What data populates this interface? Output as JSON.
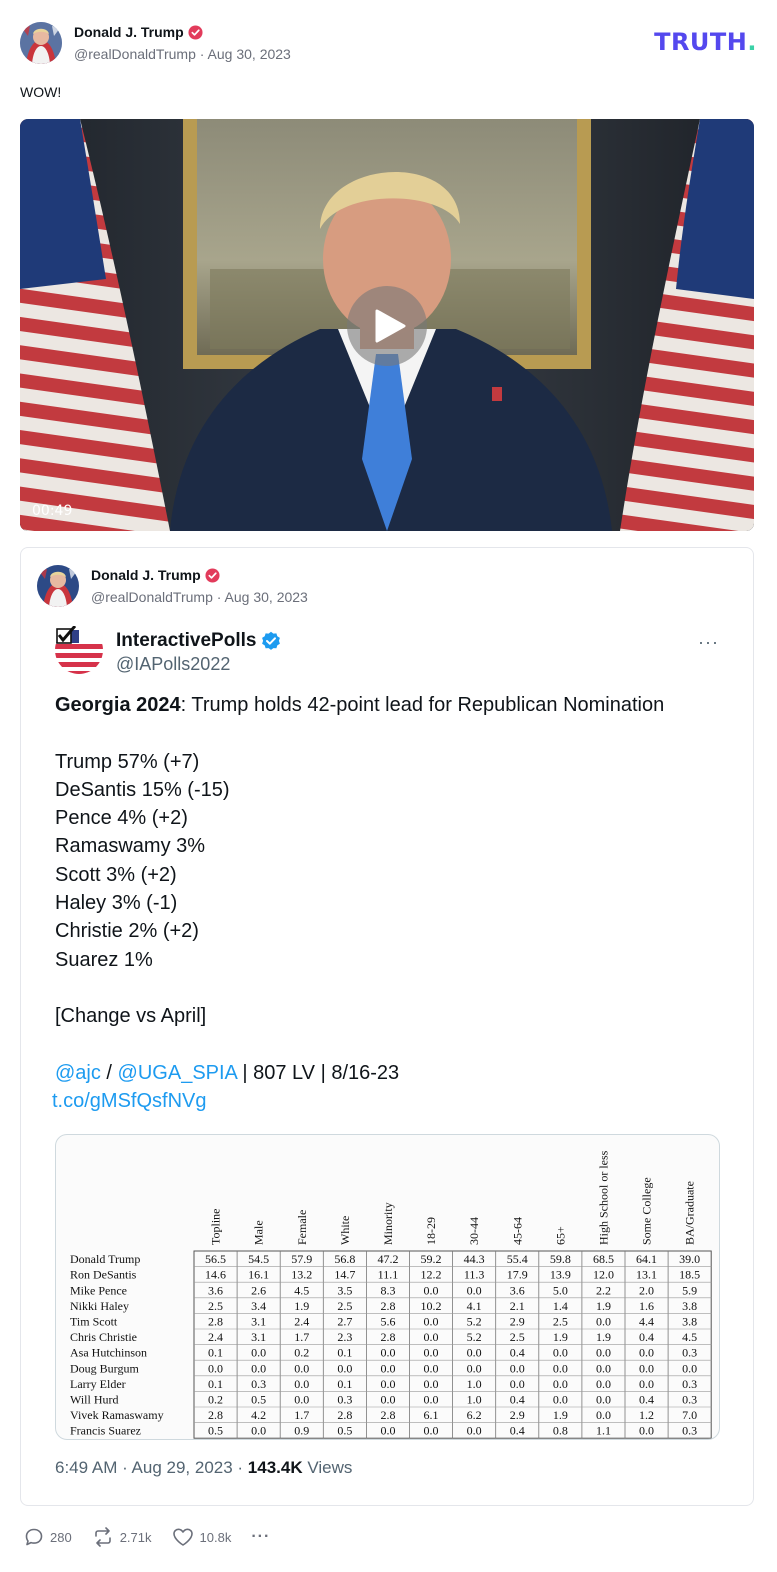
{
  "post": {
    "author_name": "Donald J. Trump",
    "handle": "@realDonaldTrump",
    "separator": "·",
    "date": "Aug 30, 2023",
    "brand": "TRUTH",
    "brand_dot": ".",
    "text": "WOW!",
    "video_duration": "00:49",
    "colors": {
      "brand": "#5448ee",
      "brand_dot": "#3bd1a7",
      "verified": "#e23b5b"
    }
  },
  "quote": {
    "author_name": "Donald J. Trump",
    "handle": "@realDonaldTrump",
    "separator": "·",
    "date": "Aug 30, 2023"
  },
  "tweet": {
    "name": "InteractivePolls",
    "handle": "@IAPolls2022",
    "more": "···",
    "headline_bold": "Georgia 2024",
    "headline_rest": ": Trump holds 42-point lead for Republican Nomination",
    "results": [
      "Trump 57% (+7)",
      "DeSantis 15% (-15)",
      "Pence 4% (+2)",
      "Ramaswamy 3%",
      "Scott 3% (+2)",
      "Haley 3% (-1)",
      "Christie 2% (+2)",
      "Suarez 1%"
    ],
    "change_note": "[Change vs April]",
    "mention1": "@ajc",
    "slash": " / ",
    "mention2": "@UGA_SPIA",
    "source_rest": " | 807 LV | 8/16-23",
    "short_link": "t.co/gMSfQsfNVg",
    "time": "6:49 AM · Aug 29, 2023 · ",
    "views_count": "143.4K",
    "views_label": " Views",
    "colors": {
      "link": "#1d9bf0",
      "verified": "#1d9bf0"
    }
  },
  "poll_table": {
    "columns": [
      "Topline",
      "Male",
      "Female",
      "White",
      "Minority",
      "18-29",
      "30-44",
      "45-64",
      "65+",
      "High School or less",
      "Some College",
      "BA/Graduate"
    ],
    "rows": [
      {
        "label": "Donald Trump",
        "values": [
          "56.5",
          "54.5",
          "57.9",
          "56.8",
          "47.2",
          "59.2",
          "44.3",
          "55.4",
          "59.8",
          "68.5",
          "64.1",
          "39.0"
        ]
      },
      {
        "label": "Ron DeSantis",
        "values": [
          "14.6",
          "16.1",
          "13.2",
          "14.7",
          "11.1",
          "12.2",
          "11.3",
          "17.9",
          "13.9",
          "12.0",
          "13.1",
          "18.5"
        ]
      },
      {
        "label": "Mike Pence",
        "values": [
          "3.6",
          "2.6",
          "4.5",
          "3.5",
          "8.3",
          "0.0",
          "0.0",
          "3.6",
          "5.0",
          "2.2",
          "2.0",
          "5.9"
        ]
      },
      {
        "label": "Nikki Haley",
        "values": [
          "2.5",
          "3.4",
          "1.9",
          "2.5",
          "2.8",
          "10.2",
          "4.1",
          "2.1",
          "1.4",
          "1.9",
          "1.6",
          "3.8"
        ]
      },
      {
        "label": "Tim Scott",
        "values": [
          "2.8",
          "3.1",
          "2.4",
          "2.7",
          "5.6",
          "0.0",
          "5.2",
          "2.9",
          "2.5",
          "0.0",
          "4.4",
          "3.8"
        ]
      },
      {
        "label": "Chris Christie",
        "values": [
          "2.4",
          "3.1",
          "1.7",
          "2.3",
          "2.8",
          "0.0",
          "5.2",
          "2.5",
          "1.9",
          "1.9",
          "0.4",
          "4.5"
        ]
      },
      {
        "label": "Asa Hutchinson",
        "values": [
          "0.1",
          "0.0",
          "0.2",
          "0.1",
          "0.0",
          "0.0",
          "0.0",
          "0.4",
          "0.0",
          "0.0",
          "0.0",
          "0.3"
        ]
      },
      {
        "label": "Doug Burgum",
        "values": [
          "0.0",
          "0.0",
          "0.0",
          "0.0",
          "0.0",
          "0.0",
          "0.0",
          "0.0",
          "0.0",
          "0.0",
          "0.0",
          "0.0"
        ]
      },
      {
        "label": "Larry Elder",
        "values": [
          "0.1",
          "0.3",
          "0.0",
          "0.1",
          "0.0",
          "0.0",
          "1.0",
          "0.0",
          "0.0",
          "0.0",
          "0.0",
          "0.3"
        ]
      },
      {
        "label": "Will Hurd",
        "values": [
          "0.2",
          "0.5",
          "0.0",
          "0.3",
          "0.0",
          "0.0",
          "1.0",
          "0.4",
          "0.0",
          "0.0",
          "0.4",
          "0.3"
        ]
      },
      {
        "label": "Vivek Ramaswamy",
        "values": [
          "2.8",
          "4.2",
          "1.7",
          "2.8",
          "2.8",
          "6.1",
          "6.2",
          "2.9",
          "1.9",
          "0.0",
          "1.2",
          "7.0"
        ]
      },
      {
        "label": "Francis Suarez",
        "values": [
          "0.5",
          "0.0",
          "0.9",
          "0.5",
          "0.0",
          "0.0",
          "0.0",
          "0.4",
          "0.8",
          "1.1",
          "0.0",
          "0.3"
        ]
      }
    ]
  },
  "actions": {
    "replies": "280",
    "retruths": "2.71k",
    "likes": "10.8k",
    "more": "···",
    "icons": [
      "reply-icon",
      "retruth-icon",
      "like-icon",
      "more-icon"
    ]
  }
}
